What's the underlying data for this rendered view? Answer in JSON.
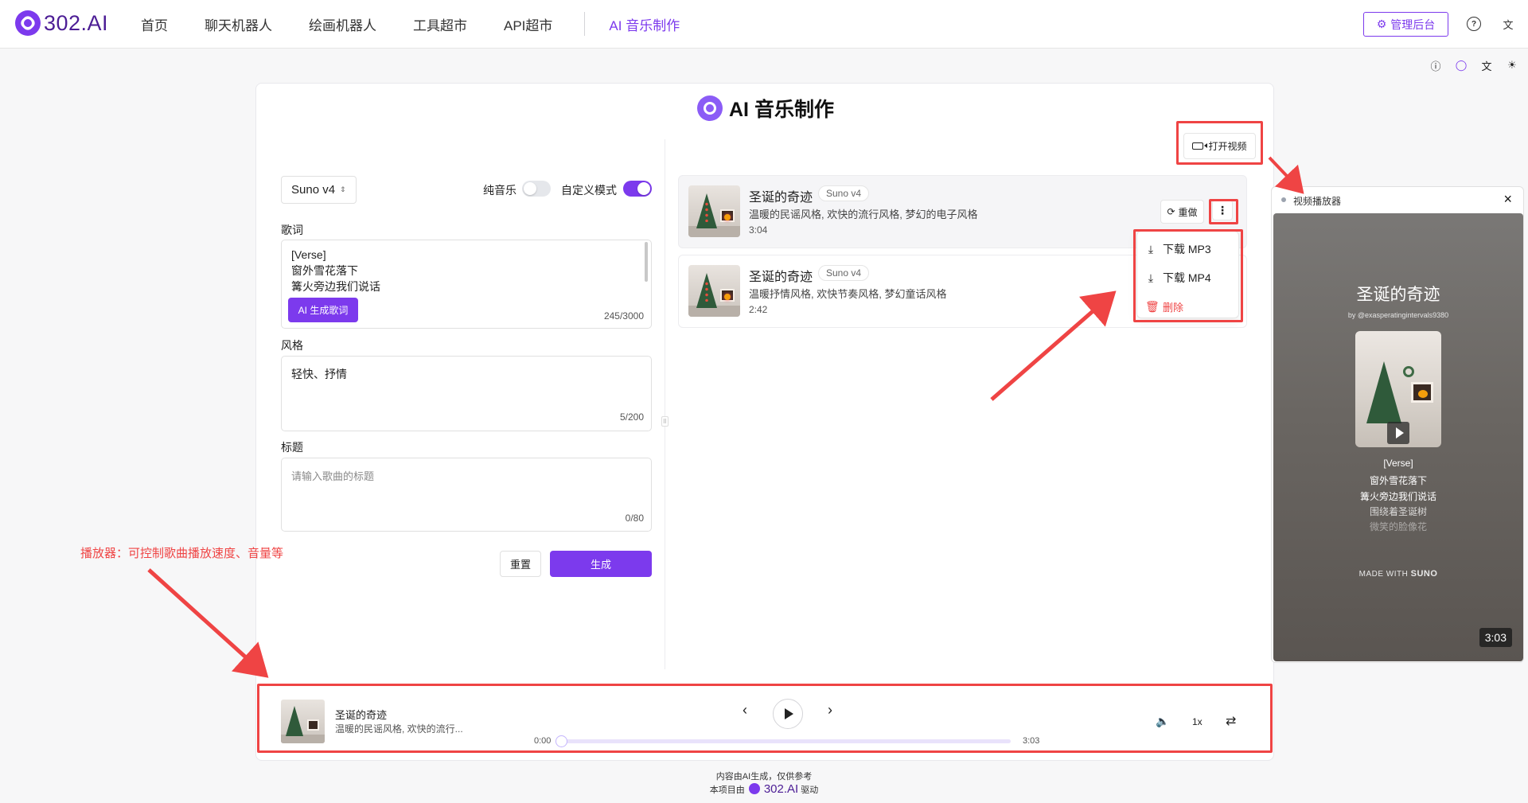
{
  "nav": {
    "logo_text": "302.AI",
    "items": [
      "首页",
      "聊天机器人",
      "绘画机器人",
      "工具超市",
      "API超市"
    ],
    "active_item": "AI 音乐制作",
    "admin_button": "管理后台"
  },
  "page": {
    "title": "AI 音乐制作",
    "open_video": "打开视频"
  },
  "form": {
    "model": "Suno v4",
    "instrumental_label": "纯音乐",
    "instrumental_on": false,
    "custom_mode_label": "自定义模式",
    "custom_mode_on": true,
    "lyrics_label": "歌词",
    "lyrics_value": "[Verse]\n窗外雪花落下\n篝火旁边我们说话",
    "ai_lyrics_button": "AI 生成歌词",
    "lyrics_counter": "245/3000",
    "style_label": "风格",
    "style_value": "轻快、抒情",
    "style_counter": "5/200",
    "title_label": "标题",
    "title_placeholder": "请输入歌曲的标题",
    "title_counter": "0/80",
    "reset_button": "重置",
    "generate_button": "生成"
  },
  "songs": [
    {
      "title": "圣诞的奇迹",
      "model": "Suno v4",
      "desc": "温暖的民谣风格, 欢快的流行风格, 梦幻的电子风格",
      "duration": "3:04"
    },
    {
      "title": "圣诞的奇迹",
      "model": "Suno v4",
      "desc": "温暖抒情风格, 欢快节奏风格, 梦幻童话风格",
      "duration": "2:42"
    }
  ],
  "song_actions": {
    "redo": "重做"
  },
  "menu": {
    "download_mp3": "下载 MP3",
    "download_mp4": "下载 MP4",
    "delete": "删除"
  },
  "video_panel": {
    "title": "视频播放器",
    "song_title": "圣诞的奇迹",
    "author": "by @exasperatingintervals9380",
    "lyrics": [
      "[Verse]",
      "窗外雪花落下",
      "篝火旁边我们说话",
      "围绕着圣诞树",
      "微笑的脸像花"
    ],
    "made_with_prefix": "MADE WITH",
    "made_with_brand": "SUNO",
    "time": "3:03"
  },
  "player": {
    "title": "圣诞的奇迹",
    "desc": "温暖的民谣风格, 欢快的流行...",
    "current": "0:00",
    "total": "3:03",
    "progress": 0,
    "speed": "1x"
  },
  "annotation": {
    "player_note": "播放器：可控制歌曲播放速度、音量等"
  },
  "footer": {
    "line1": "内容由AI生成，仅供参考",
    "line2_prefix": "本项目由",
    "brand": "302.AI",
    "line2_suffix": "驱动"
  },
  "colors": {
    "accent": "#7c3aed",
    "annotation": "#ef4444"
  }
}
